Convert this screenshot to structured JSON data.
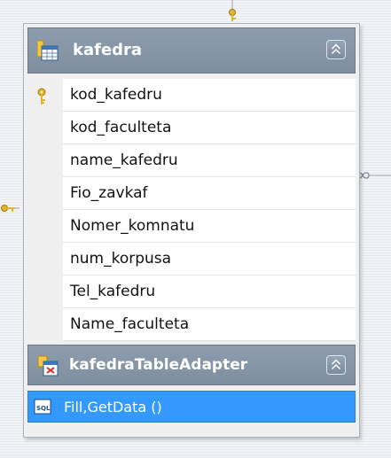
{
  "table": {
    "title": "kafedra",
    "icon": "table-icon",
    "fields": [
      {
        "name": "kod_kafedru",
        "is_key": true
      },
      {
        "name": "kod_faculteta",
        "is_key": false
      },
      {
        "name": "name_kafedru",
        "is_key": false
      },
      {
        "name": "Fio_zavkaf",
        "is_key": false
      },
      {
        "name": "Nomer_komnatu",
        "is_key": false
      },
      {
        "name": "num_korpusa",
        "is_key": false
      },
      {
        "name": "Tel_kafedru",
        "is_key": false
      },
      {
        "name": "Name_faculteta",
        "is_key": false
      }
    ]
  },
  "adapter": {
    "title": "kafedraTableAdapter",
    "icon": "table-adapter-icon",
    "method": "Fill,GetData ()",
    "method_icon": "sql-query-icon"
  },
  "colors": {
    "header": "#8696a7",
    "selected": "#3399ff",
    "key_gold": "#e2b52e"
  }
}
